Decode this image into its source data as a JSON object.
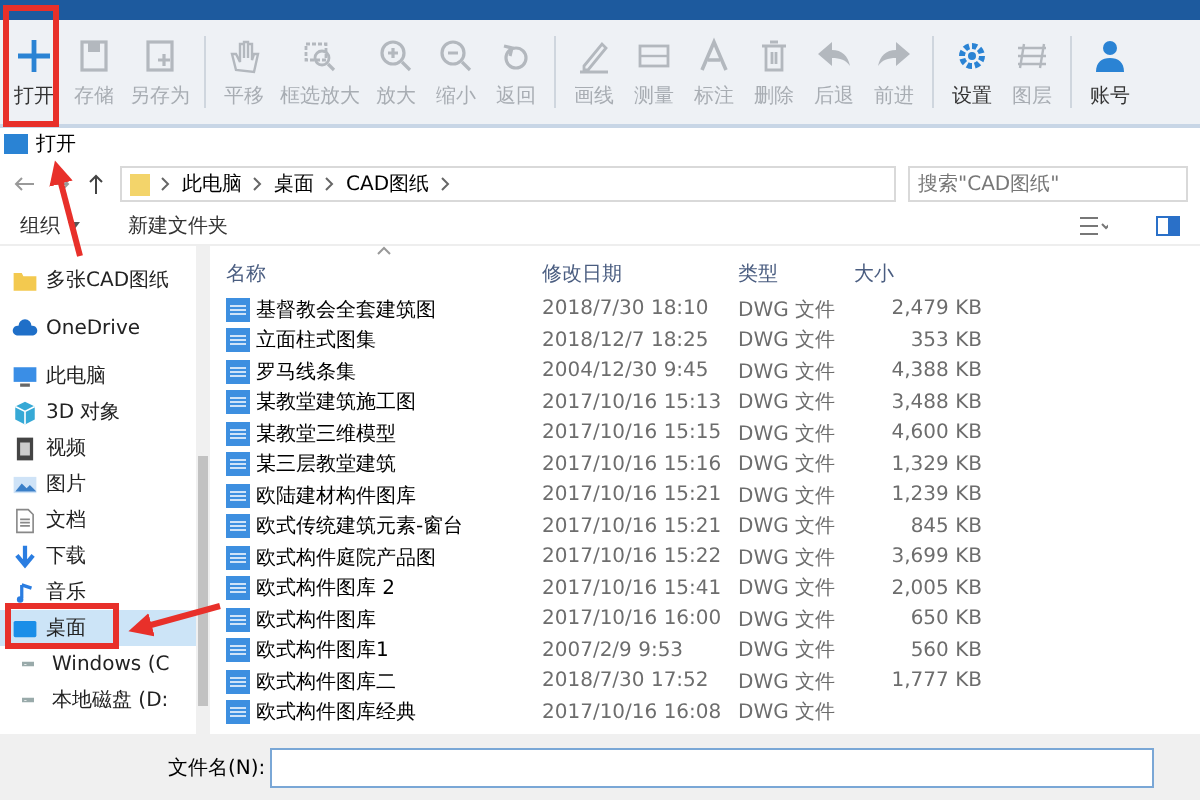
{
  "toolbar": {
    "groups": [
      [
        {
          "label": "打开",
          "disabled": false
        },
        {
          "label": "存储",
          "disabled": true
        },
        {
          "label": "另存为",
          "disabled": true
        }
      ],
      [
        {
          "label": "平移",
          "disabled": true
        },
        {
          "label": "框选放大",
          "disabled": true
        },
        {
          "label": "放大",
          "disabled": true
        },
        {
          "label": "缩小",
          "disabled": true
        },
        {
          "label": "返回",
          "disabled": true
        }
      ],
      [
        {
          "label": "画线",
          "disabled": true
        },
        {
          "label": "测量",
          "disabled": true
        },
        {
          "label": "标注",
          "disabled": true
        },
        {
          "label": "删除",
          "disabled": true
        },
        {
          "label": "后退",
          "disabled": true
        },
        {
          "label": "前进",
          "disabled": true
        }
      ],
      [
        {
          "label": "设置",
          "disabled": false
        },
        {
          "label": "图层",
          "disabled": true
        }
      ],
      [
        {
          "label": "账号",
          "disabled": false
        }
      ]
    ]
  },
  "dialog": {
    "title": "打开",
    "breadcrumb": [
      "此电脑",
      "桌面",
      "CAD图纸"
    ],
    "search": {
      "placeholder": "搜索\"CAD图纸\""
    },
    "commands": {
      "organize": "组织",
      "new_folder": "新建文件夹"
    },
    "sidebar": [
      {
        "label": "多张CAD图纸",
        "kind": "folder",
        "selected": false
      },
      {
        "label": "OneDrive",
        "kind": "cloud",
        "selected": false
      },
      {
        "label": "此电脑",
        "kind": "pc",
        "selected": false
      },
      {
        "label": "3D 对象",
        "kind": "cube",
        "selected": false
      },
      {
        "label": "视频",
        "kind": "video",
        "selected": false
      },
      {
        "label": "图片",
        "kind": "image",
        "selected": false
      },
      {
        "label": "文档",
        "kind": "doc",
        "selected": false
      },
      {
        "label": "下载",
        "kind": "download",
        "selected": false
      },
      {
        "label": "音乐",
        "kind": "music",
        "selected": false
      },
      {
        "label": "桌面",
        "kind": "desktop",
        "selected": true
      },
      {
        "label": "Windows (C",
        "kind": "drive",
        "selected": false
      },
      {
        "label": "本地磁盘 (D:",
        "kind": "drive",
        "selected": false
      }
    ],
    "columns": [
      "名称",
      "修改日期",
      "类型",
      "大小"
    ],
    "files": [
      {
        "name": "基督教会全套建筑图",
        "date": "2018/7/30 18:10",
        "type": "DWG 文件",
        "size": "2,479 KB"
      },
      {
        "name": "立面柱式图集",
        "date": "2018/12/7 18:25",
        "type": "DWG 文件",
        "size": "353 KB"
      },
      {
        "name": "罗马线条集",
        "date": "2004/12/30 9:45",
        "type": "DWG 文件",
        "size": "4,388 KB"
      },
      {
        "name": "某教堂建筑施工图",
        "date": "2017/10/16 15:13",
        "type": "DWG 文件",
        "size": "3,488 KB"
      },
      {
        "name": "某教堂三维模型",
        "date": "2017/10/16 15:15",
        "type": "DWG 文件",
        "size": "4,600 KB"
      },
      {
        "name": "某三层教堂建筑",
        "date": "2017/10/16 15:16",
        "type": "DWG 文件",
        "size": "1,329 KB"
      },
      {
        "name": "欧陆建材构件图库",
        "date": "2017/10/16 15:21",
        "type": "DWG 文件",
        "size": "1,239 KB"
      },
      {
        "name": "欧式传统建筑元素-窗台",
        "date": "2017/10/16 15:21",
        "type": "DWG 文件",
        "size": "845 KB"
      },
      {
        "name": "欧式构件庭院产品图",
        "date": "2017/10/16 15:22",
        "type": "DWG 文件",
        "size": "3,699 KB"
      },
      {
        "name": "欧式构件图库 2",
        "date": "2017/10/16 15:41",
        "type": "DWG 文件",
        "size": "2,005 KB"
      },
      {
        "name": "欧式构件图库",
        "date": "2017/10/16 16:00",
        "type": "DWG 文件",
        "size": "650 KB"
      },
      {
        "name": "欧式构件图库1",
        "date": "2007/2/9 9:53",
        "type": "DWG 文件",
        "size": "560 KB"
      },
      {
        "name": "欧式构件图库二",
        "date": "2018/7/30 17:52",
        "type": "DWG 文件",
        "size": "1,777 KB"
      },
      {
        "name": "欧式构件图库经典",
        "date": "2017/10/16 16:08",
        "type": "DWG 文件"
      }
    ],
    "filename": {
      "label": "文件名(N):"
    }
  }
}
